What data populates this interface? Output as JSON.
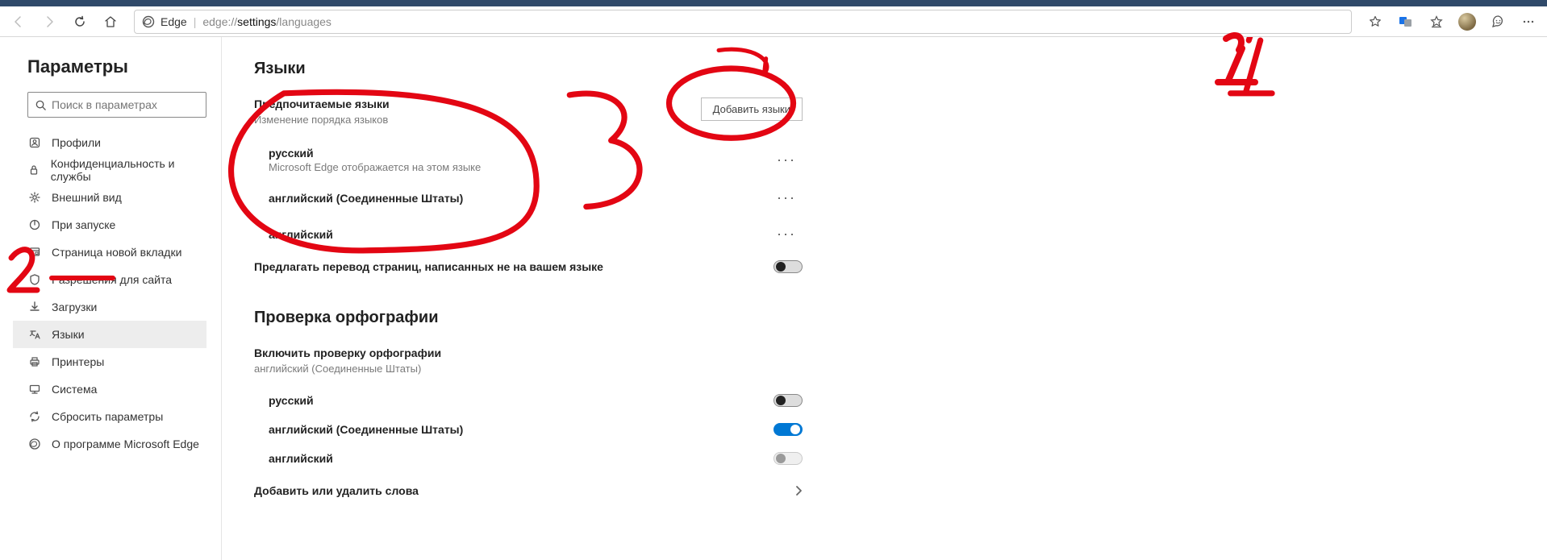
{
  "address": {
    "product": "Edge",
    "prefix": "edge://",
    "bold": "settings",
    "rest": "/languages"
  },
  "sidebar": {
    "title": "Параметры",
    "search_placeholder": "Поиск в параметрах",
    "items": [
      {
        "label": "Профили"
      },
      {
        "label": "Конфиденциальность и службы"
      },
      {
        "label": "Внешний вид"
      },
      {
        "label": "При запуске"
      },
      {
        "label": "Страница новой вкладки"
      },
      {
        "label": "Разрешения для сайта"
      },
      {
        "label": "Загрузки"
      },
      {
        "label": "Языки"
      },
      {
        "label": "Принтеры"
      },
      {
        "label": "Система"
      },
      {
        "label": "Сбросить параметры"
      },
      {
        "label": "О программе Microsoft Edge"
      }
    ]
  },
  "languages": {
    "heading": "Языки",
    "pref_heading": "Предпочитаемые языки",
    "pref_sub": "Изменение порядка языков",
    "add_button": "Добавить языки",
    "list": [
      {
        "name": "русский",
        "sub": "Microsoft Edge отображается на этом языке"
      },
      {
        "name": "английский (Соединенные Штаты)"
      },
      {
        "name": "английский"
      }
    ],
    "offer_translate": "Предлагать перевод страниц, написанных не на вашем языке"
  },
  "spell": {
    "heading": "Проверка орфографии",
    "enable_label": "Включить проверку орфографии",
    "enable_sub": "английский (Соединенные Штаты)",
    "langs": [
      {
        "name": "русский",
        "on": false,
        "disabled": false
      },
      {
        "name": "английский (Соединенные Штаты)",
        "on": true,
        "disabled": false
      },
      {
        "name": "английский",
        "on": false,
        "disabled": true
      }
    ],
    "add_words": "Добавить или удалить слова"
  }
}
